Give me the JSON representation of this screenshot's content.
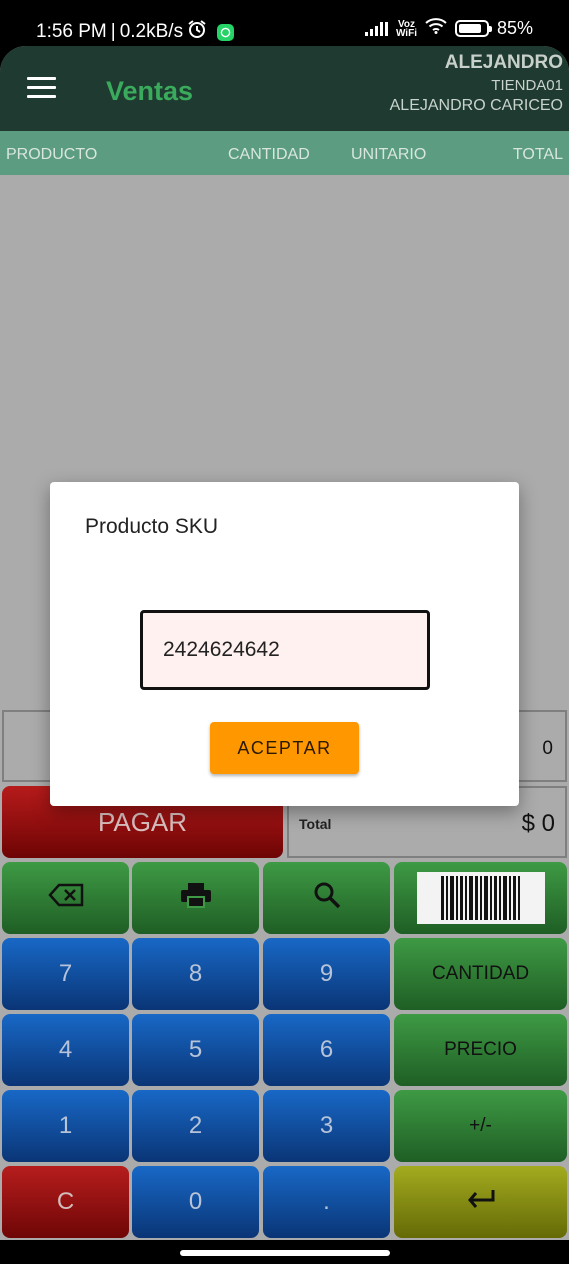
{
  "status_bar": {
    "time": "1:56 PM",
    "separator": "|",
    "net_speed": "0.2kB/s",
    "voz_top": "Voz",
    "voz_bottom": "WiFi",
    "battery": "85%",
    "icons": [
      "alarm-icon",
      "whatsapp-icon",
      "signal-icon",
      "wifi-icon",
      "battery-icon"
    ]
  },
  "header": {
    "title": "Ventas",
    "user_name": "ALEJANDRO",
    "store": "TIENDA01",
    "user_full": "ALEJANDRO CARICEO"
  },
  "columns": [
    "PRODUCTO",
    "CANTIDAD",
    "UNITARIO",
    "TOTAL"
  ],
  "quantity_display": "0",
  "pay_label": "PAGAR",
  "total": {
    "label": "Total",
    "value": "$ 0"
  },
  "keypad": {
    "row1_icons": [
      "backspace-icon",
      "print-icon",
      "search-icon",
      "barcode-icon"
    ],
    "digits": [
      "7",
      "8",
      "9",
      "4",
      "5",
      "6",
      "1",
      "2",
      "3",
      "C",
      "0",
      "."
    ],
    "side": [
      "CANTIDAD",
      "PRECIO",
      "+/-"
    ],
    "enter_icon": "enter-icon"
  },
  "dialog": {
    "title": "Producto SKU",
    "input_value": "2424624642",
    "accept_label": "ACEPTAR"
  },
  "colors": {
    "header_bg": "#1f3a30",
    "title_green": "#3aaa5c",
    "column_bar": "#5c9c80",
    "accept_orange": "#ff9800",
    "pay_red": "#b71b1b",
    "digit_blue": "#1868c6",
    "function_green": "#3e9a44",
    "enter_olive": "#a3ab1f"
  }
}
